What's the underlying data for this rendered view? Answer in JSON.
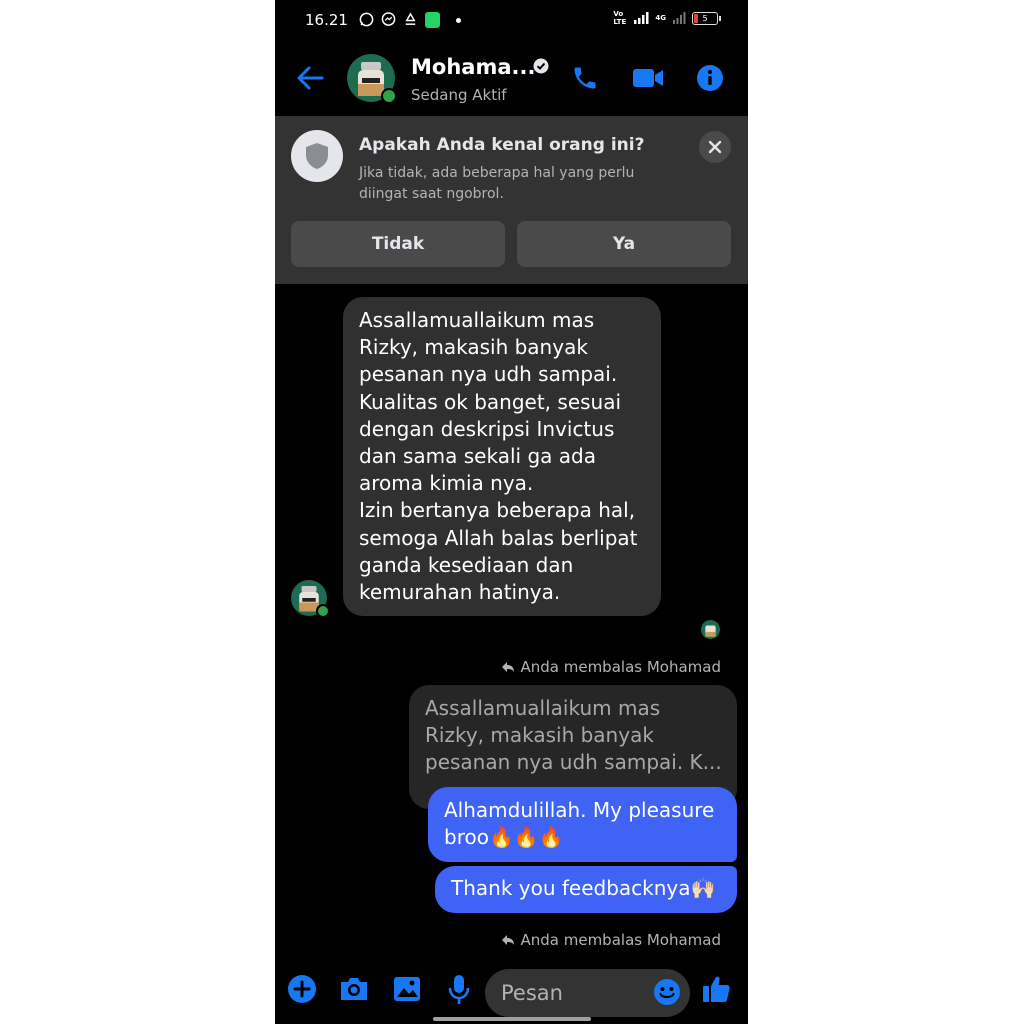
{
  "status_bar": {
    "time": "16.21",
    "network_label": "Vo LTE",
    "signal_label": "4G",
    "battery_level": "5"
  },
  "header": {
    "contact_name": "Mohama...",
    "active_status": "Sedang Aktif"
  },
  "safety_banner": {
    "title": "Apakah Anda kenal orang ini?",
    "description": "Jika tidak, ada beberapa hal yang perlu diingat saat ngobrol.",
    "no_button": "Tidak",
    "yes_button": "Ya"
  },
  "messages": {
    "incoming": "Assallamuallaikum mas\nRizky, makasih banyak\npesanan nya udh sampai.\nKualitas ok banget, sesuai\ndengan deskripsi Invictus\ndan sama sekali ga ada\naroma kimia nya.\nIzin bertanya beberapa hal,\nsemoga Allah balas berlipat\nganda kesediaan dan\nkemurahan hatinya.",
    "reply_label_1": "Anda membalas Mohamad",
    "quoted": "Assallamuallaikum mas\nRizky, makasih banyak\npesanan nya udh sampai. K...",
    "outgoing_1": "Alhamdulillah. My pleasure\nbroo🔥🔥🔥",
    "outgoing_2": "Thank you feedbacknya🙌🏻",
    "reply_label_2": "Anda membalas Mohamad"
  },
  "composer": {
    "placeholder": "Pesan"
  },
  "colors": {
    "accent": "#3e63f5",
    "header_icons": "#1877f2",
    "online": "#31a24c",
    "background": "#000000",
    "incoming_bubble": "#303030"
  },
  "icons": [
    "back-arrow-icon",
    "verified-icon",
    "phone-icon",
    "video-camera-icon",
    "info-icon",
    "shield-icon",
    "close-icon",
    "reply-icon",
    "plus-icon",
    "camera-icon",
    "gallery-icon",
    "microphone-icon",
    "emoji-icon",
    "thumbs-up-icon"
  ]
}
